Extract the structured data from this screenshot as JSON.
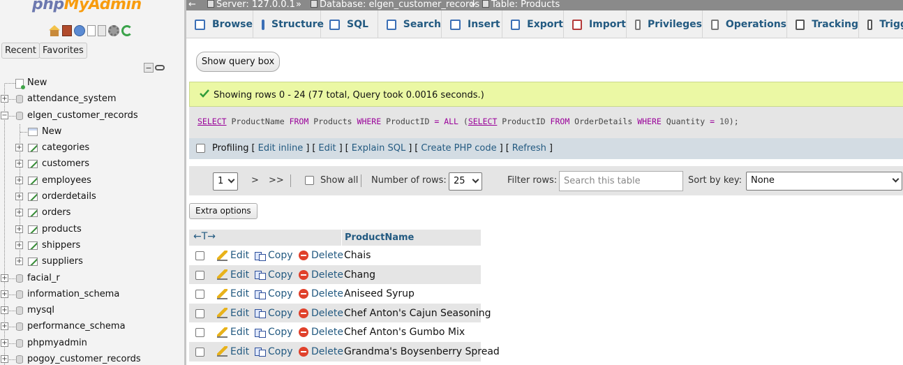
{
  "app": {
    "logo_php": "php",
    "logo_rest": "MyAdmin"
  },
  "left_panel": {
    "recent_label": "Recent",
    "favorites_label": "Favorites",
    "tree": [
      {
        "label": "New",
        "kind": "new"
      },
      {
        "label": "attendance_system",
        "kind": "db",
        "expanded": false
      },
      {
        "label": "elgen_customer_records",
        "kind": "db",
        "expanded": true
      },
      {
        "label": "New",
        "kind": "new-table"
      },
      {
        "label": "categories",
        "kind": "table"
      },
      {
        "label": "customers",
        "kind": "table"
      },
      {
        "label": "employees",
        "kind": "table"
      },
      {
        "label": "orderdetails",
        "kind": "table"
      },
      {
        "label": "orders",
        "kind": "table"
      },
      {
        "label": "products",
        "kind": "table"
      },
      {
        "label": "shippers",
        "kind": "table"
      },
      {
        "label": "suppliers",
        "kind": "table"
      },
      {
        "label": "facial_r",
        "kind": "db",
        "expanded": false
      },
      {
        "label": "information_schema",
        "kind": "db",
        "expanded": false
      },
      {
        "label": "mysql",
        "kind": "db",
        "expanded": false
      },
      {
        "label": "performance_schema",
        "kind": "db",
        "expanded": false
      },
      {
        "label": "phpmyadmin",
        "kind": "db",
        "expanded": false
      },
      {
        "label": "pogoy_customer_records",
        "kind": "db",
        "expanded": false
      }
    ]
  },
  "breadcrumb": {
    "server": "Server: 127.0.0.1",
    "database": "Database: elgen_customer_records",
    "table": "Table: Products",
    "separator": "»"
  },
  "menu_tabs": [
    {
      "label": "Browse",
      "icon": "browse-icon"
    },
    {
      "label": "Structure",
      "icon": "structure-icon"
    },
    {
      "label": "SQL",
      "icon": "sql-icon"
    },
    {
      "label": "Search",
      "icon": "search-icon"
    },
    {
      "label": "Insert",
      "icon": "insert-icon"
    },
    {
      "label": "Export",
      "icon": "export-icon"
    },
    {
      "label": "Import",
      "icon": "import-icon"
    },
    {
      "label": "Privileges",
      "icon": "privileges-icon"
    },
    {
      "label": "Operations",
      "icon": "operations-icon"
    },
    {
      "label": "Tracking",
      "icon": "tracking-icon"
    },
    {
      "label": "Trigg",
      "icon": "triggers-icon"
    }
  ],
  "query_box_button": "Show query box",
  "success": {
    "message": "Showing rows 0 - 24 (77 total, Query took 0.0016 seconds.)"
  },
  "sql": {
    "tokens": [
      {
        "t": "SELECT",
        "c": "kwu"
      },
      {
        "t": " ProductName ",
        "c": ""
      },
      {
        "t": "FROM",
        "c": "kw"
      },
      {
        "t": " Products ",
        "c": ""
      },
      {
        "t": "WHERE",
        "c": "kw"
      },
      {
        "t": " ProductID ",
        "c": ""
      },
      {
        "t": "=",
        "c": "kw"
      },
      {
        "t": " ",
        "c": ""
      },
      {
        "t": "ALL",
        "c": "kw"
      },
      {
        "t": " (",
        "c": ""
      },
      {
        "t": "SELECT",
        "c": "kwu"
      },
      {
        "t": " ProductID ",
        "c": ""
      },
      {
        "t": "FROM",
        "c": "kw"
      },
      {
        "t": " OrderDetails ",
        "c": ""
      },
      {
        "t": "WHERE",
        "c": "kw"
      },
      {
        "t": " Quantity ",
        "c": ""
      },
      {
        "t": "=",
        "c": "kw"
      },
      {
        "t": " ",
        "c": ""
      },
      {
        "t": "10",
        "c": "num"
      },
      {
        "t": ");",
        "c": ""
      }
    ]
  },
  "profiling": {
    "label": "Profiling",
    "links": [
      "Edit inline",
      "Edit",
      "Explain SQL",
      "Create PHP code",
      "Refresh"
    ]
  },
  "navigation": {
    "page_value": "1",
    "next": ">",
    "last": ">>",
    "show_all_label": "Show all",
    "rows_label": "Number of rows:",
    "rows_value": "25",
    "filter_label": "Filter rows:",
    "filter_placeholder": "Search this table",
    "sort_label": "Sort by key:",
    "sort_value": "None"
  },
  "extra_options_label": "Extra options",
  "results": {
    "column_header": "ProductName",
    "actions": {
      "edit": "Edit",
      "copy": "Copy",
      "delete": "Delete"
    },
    "rows": [
      "Chais",
      "Chang",
      "Aniseed Syrup",
      "Chef Anton's Cajun Seasoning",
      "Chef Anton's Gumbo Mix",
      "Grandma's Boysenberry Spread"
    ]
  }
}
